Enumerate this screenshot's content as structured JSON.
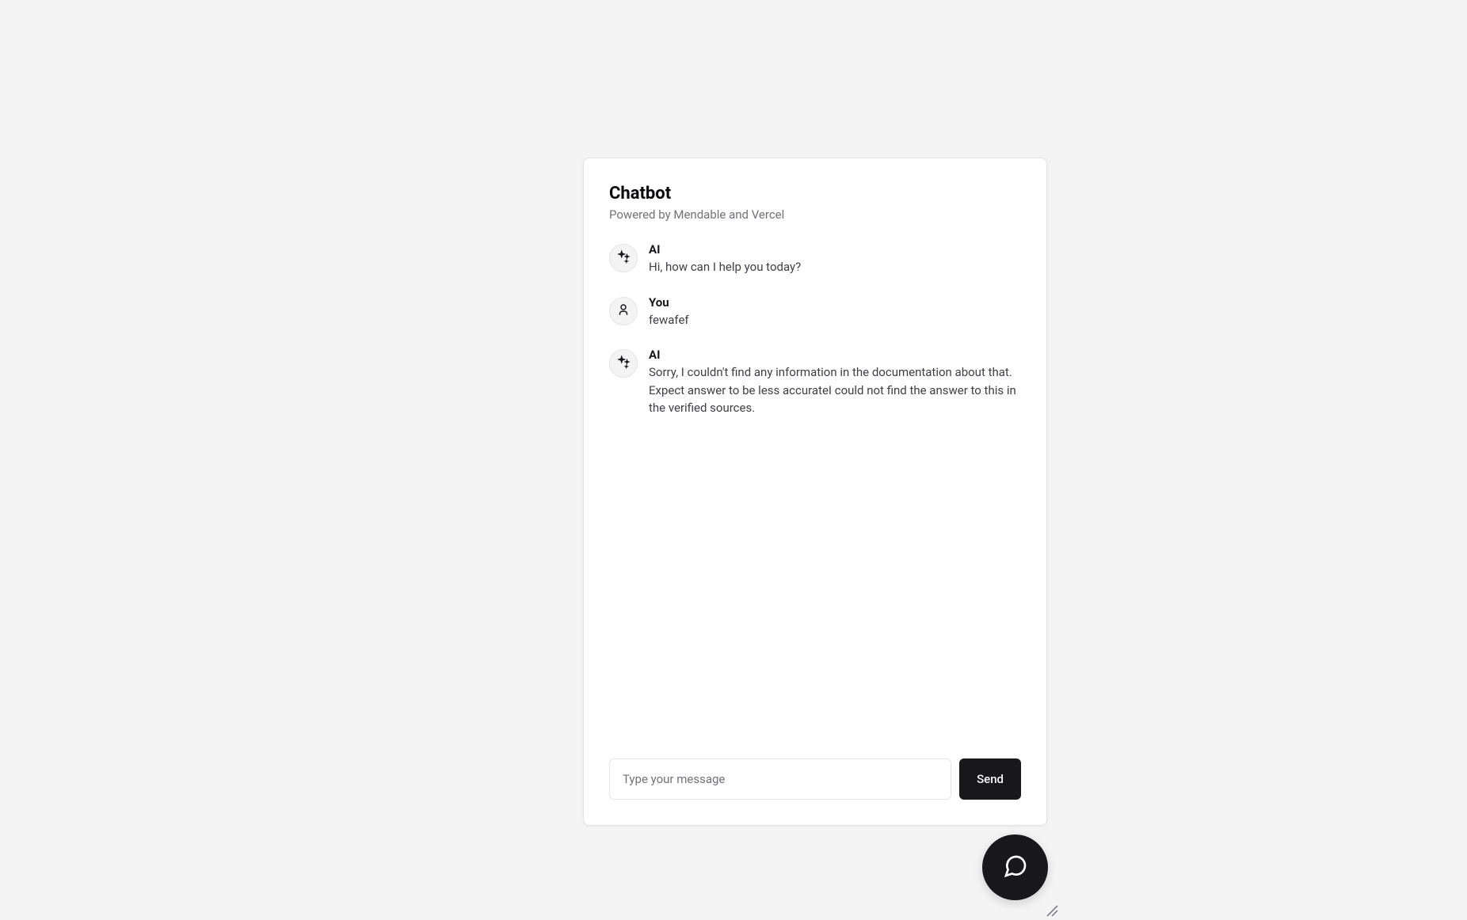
{
  "header": {
    "title": "Chatbot",
    "subtitle": "Powered by Mendable and Vercel"
  },
  "messages": [
    {
      "role": "ai",
      "sender": "AI",
      "text": "Hi, how can I help you today?"
    },
    {
      "role": "user",
      "sender": "You",
      "text": "fewafef"
    },
    {
      "role": "ai",
      "sender": "AI",
      "text": "Sorry, I couldn't find any information in the documentation about that. Expect answer to be less accurateI could not find the answer to this in the verified sources."
    }
  ],
  "input": {
    "placeholder": "Type your message",
    "value": ""
  },
  "send_label": "Send"
}
